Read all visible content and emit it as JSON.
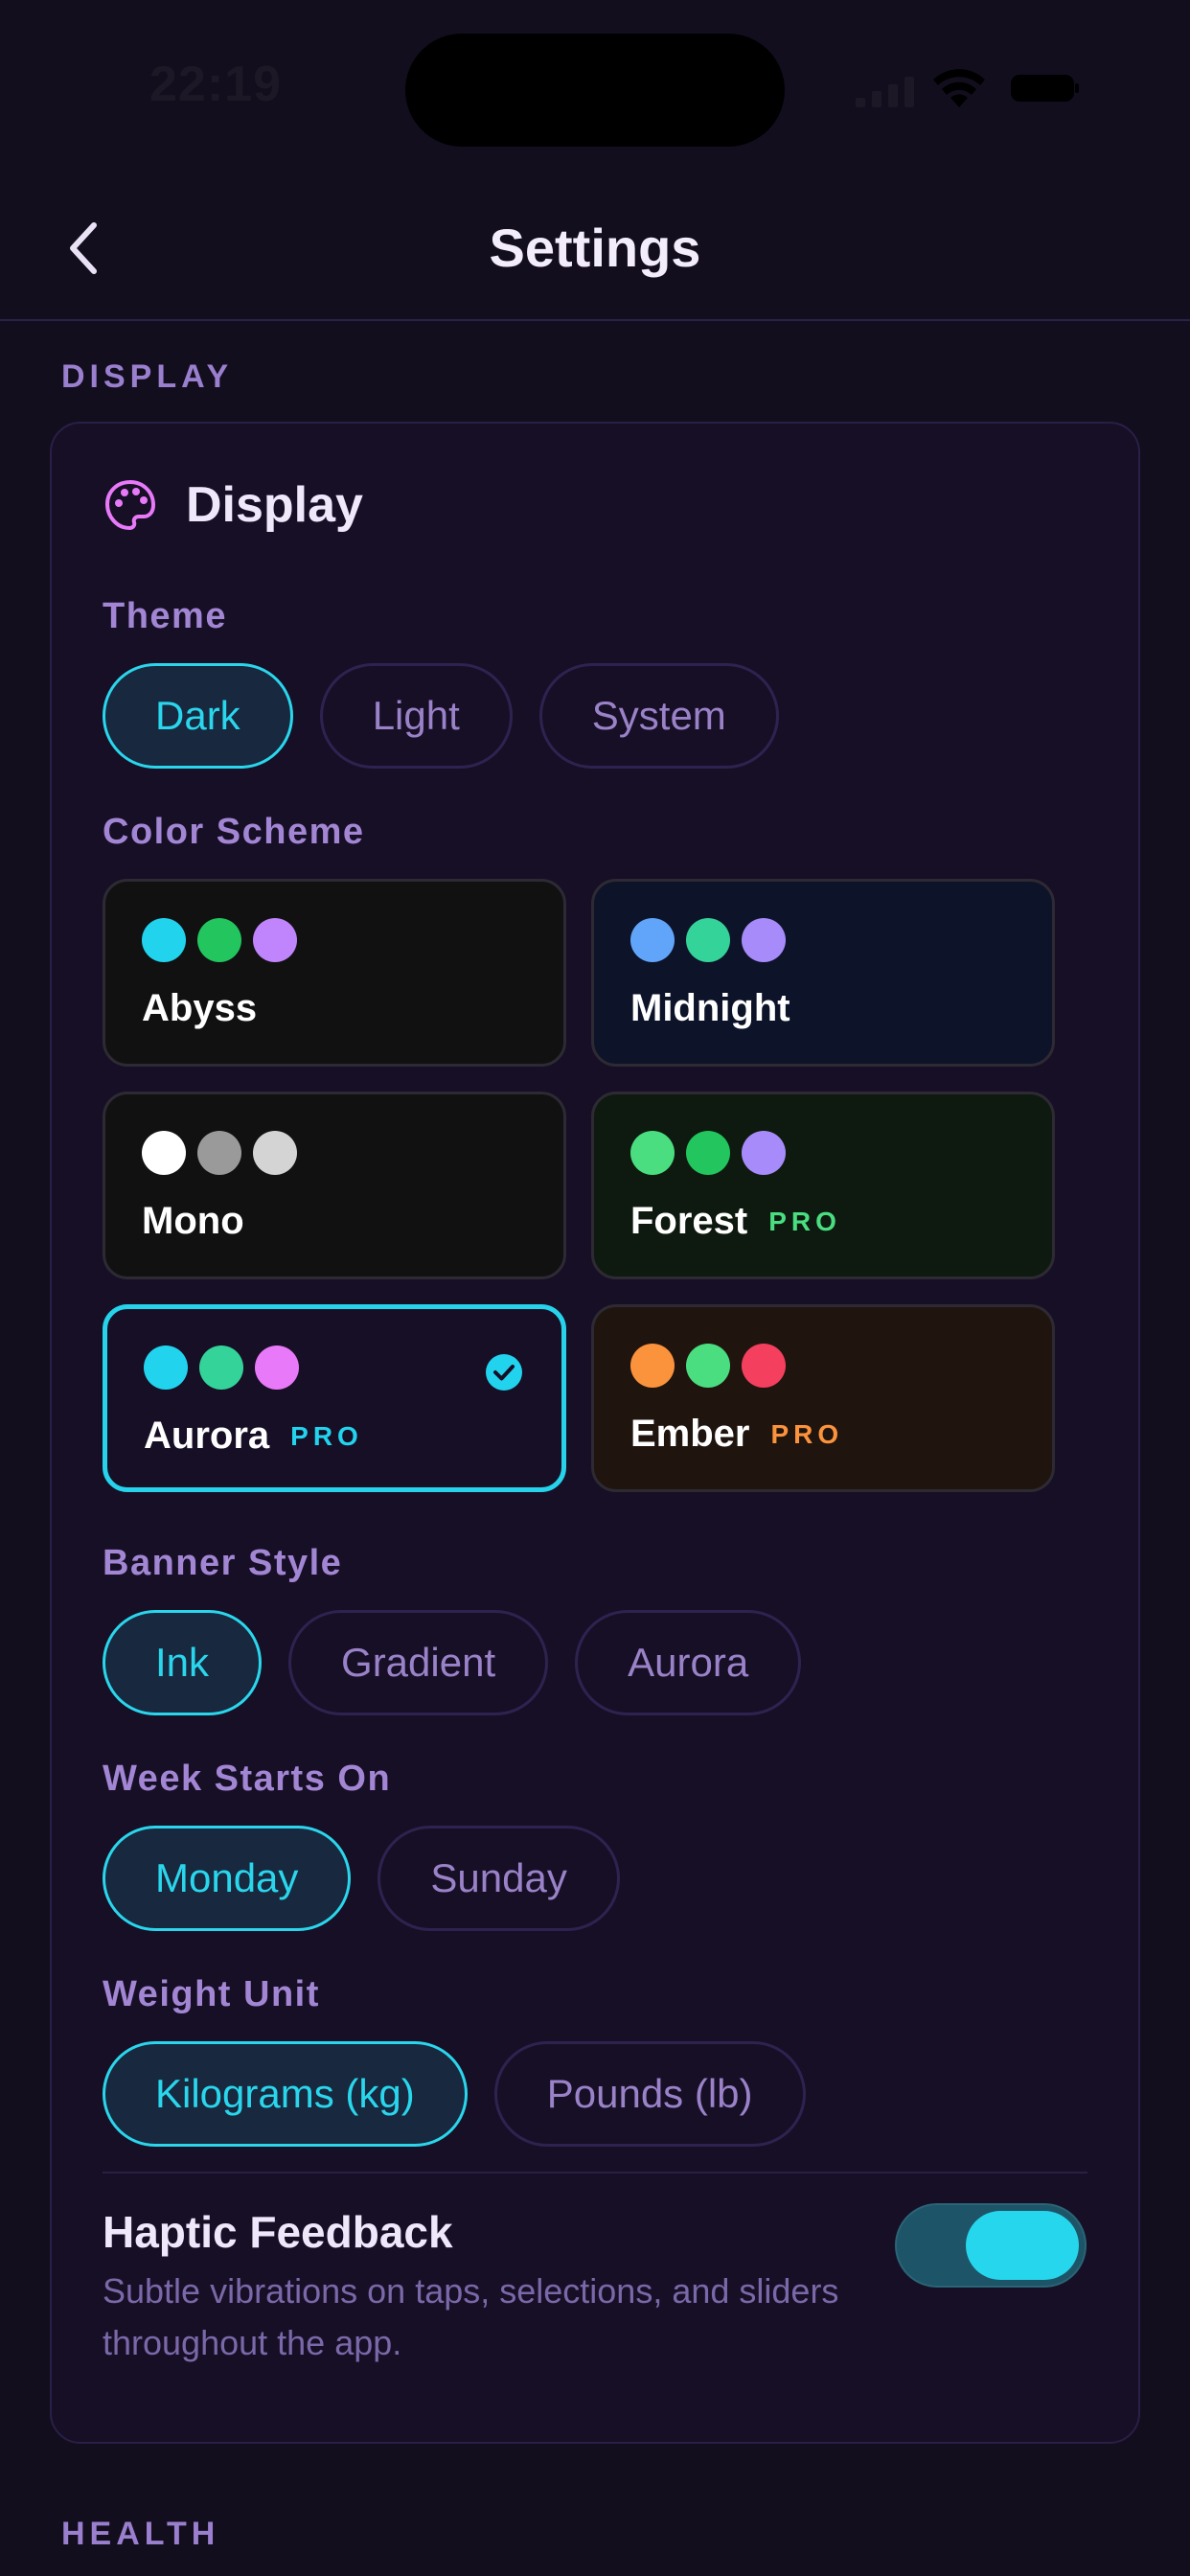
{
  "status_bar": {
    "time": "22:19"
  },
  "nav": {
    "title": "Settings"
  },
  "sections": {
    "display": "DISPLAY",
    "health": "HEALTH"
  },
  "card": {
    "title": "Display"
  },
  "theme": {
    "label": "Theme",
    "options": [
      {
        "label": "Dark",
        "selected": true
      },
      {
        "label": "Light",
        "selected": false
      },
      {
        "label": "System",
        "selected": false
      }
    ]
  },
  "color_scheme": {
    "label": "Color Scheme",
    "options": [
      {
        "name": "Abyss",
        "pro": "",
        "bg": "#111111",
        "dots": [
          "#22d3ee",
          "#22c55e",
          "#c084fc"
        ],
        "selected": false
      },
      {
        "name": "Midnight",
        "pro": "",
        "bg": "#0d1329",
        "dots": [
          "#60a5fa",
          "#34d399",
          "#a78bfa"
        ],
        "selected": false
      },
      {
        "name": "Mono",
        "pro": "",
        "bg": "#111111",
        "dots": [
          "#ffffff",
          "#9a9a9a",
          "#d4d4d4"
        ],
        "selected": false
      },
      {
        "name": "Forest",
        "pro": "PRO",
        "pro_color": "#4ade80",
        "bg": "#0e1a0f",
        "dots": [
          "#4ade80",
          "#22c55e",
          "#a78bfa"
        ],
        "selected": false
      },
      {
        "name": "Aurora",
        "pro": "PRO",
        "pro_color": "#22d3ee",
        "bg": "#170f26",
        "dots": [
          "#22d3ee",
          "#34d399",
          "#e879f9"
        ],
        "selected": true
      },
      {
        "name": "Ember",
        "pro": "PRO",
        "pro_color": "#fb923c",
        "bg": "#20140e",
        "dots": [
          "#fb923c",
          "#4ade80",
          "#f43f5e"
        ],
        "selected": false
      }
    ]
  },
  "banner_style": {
    "label": "Banner Style",
    "options": [
      {
        "label": "Ink",
        "selected": true
      },
      {
        "label": "Gradient",
        "selected": false
      },
      {
        "label": "Aurora",
        "selected": false
      }
    ]
  },
  "week_starts": {
    "label": "Week Starts On",
    "options": [
      {
        "label": "Monday",
        "selected": true
      },
      {
        "label": "Sunday",
        "selected": false
      }
    ]
  },
  "weight_unit": {
    "label": "Weight Unit",
    "options": [
      {
        "label": "Kilograms (kg)",
        "selected": true
      },
      {
        "label": "Pounds (lb)",
        "selected": false
      }
    ]
  },
  "haptic": {
    "title": "Haptic Feedback",
    "description": "Subtle vibrations on taps, selections, and sliders throughout the app.",
    "enabled": true
  },
  "colors": {
    "accent": "#22d3ee",
    "background": "#130e1e",
    "card": "#170f26",
    "label": "#a286d4"
  },
  "icons": {
    "back": "chevron-left-icon",
    "palette": "palette-icon",
    "check": "check-circle-icon",
    "wifi": "wifi-icon",
    "signal": "cellular-signal-icon",
    "battery": "battery-icon"
  }
}
